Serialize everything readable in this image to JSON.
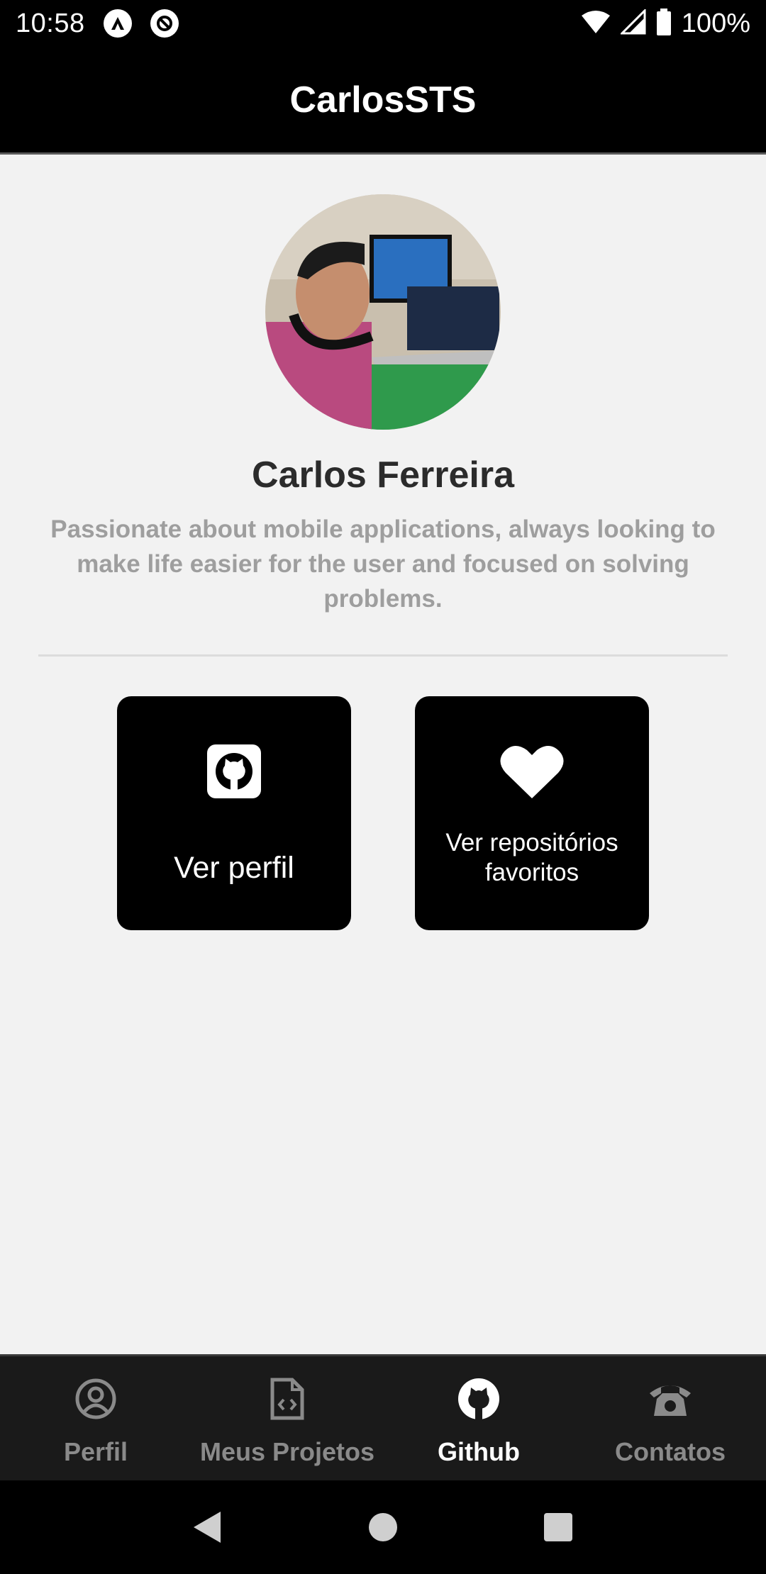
{
  "status_bar": {
    "time": "10:58",
    "battery": "100%",
    "icons": [
      "notification-a-icon",
      "notification-at-icon",
      "wifi-icon",
      "signal-icon",
      "battery-icon"
    ]
  },
  "header": {
    "title": "CarlosSTS"
  },
  "profile": {
    "name": "Carlos Ferreira",
    "bio": "Passionate about mobile applications, always looking to make life easier for the user and focused on solving problems."
  },
  "actions": {
    "view_profile": {
      "label": "Ver perfil",
      "icon": "github-icon"
    },
    "favorites": {
      "label": "Ver repositórios favoritos",
      "icon": "heart-icon"
    }
  },
  "bottom_nav": {
    "items": [
      {
        "label": "Perfil",
        "icon": "user-circle-icon",
        "active": false
      },
      {
        "label": "Meus Projetos",
        "icon": "code-file-icon",
        "active": false
      },
      {
        "label": "Github",
        "icon": "github-icon",
        "active": true
      },
      {
        "label": "Contatos",
        "icon": "phone-icon",
        "active": false
      }
    ]
  },
  "colors": {
    "background": "#f2f2f2",
    "header": "#000000",
    "card": "#000000",
    "nav_bg": "#1a1a1a",
    "nav_active": "#ffffff",
    "nav_inactive": "#8a8a8a",
    "bio_text": "#9e9e9e"
  }
}
